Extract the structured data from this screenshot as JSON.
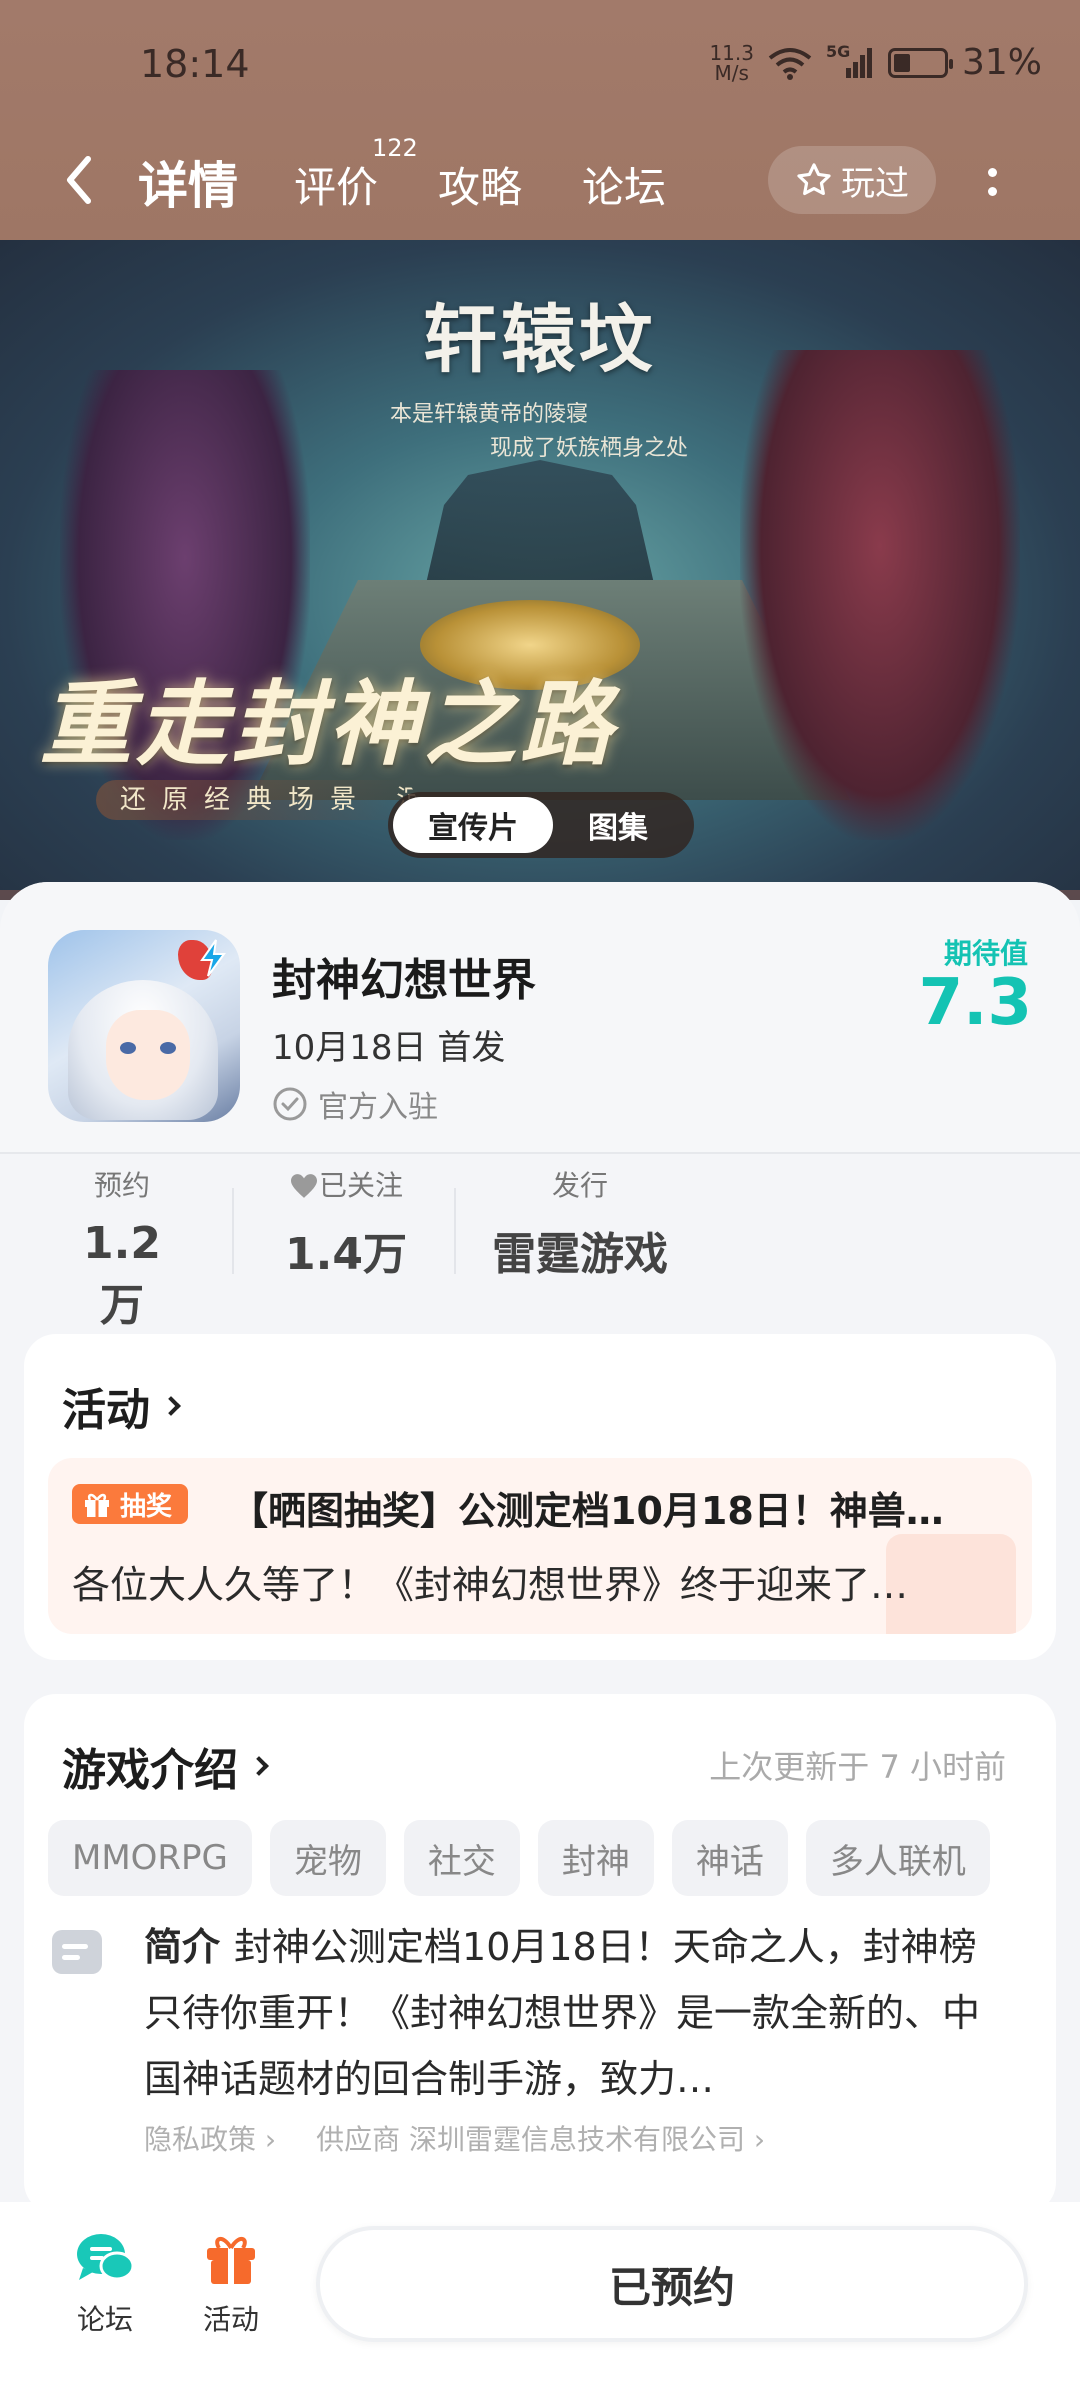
{
  "status_bar": {
    "time": "18:14",
    "net_speed_value": "11.3",
    "net_speed_unit": "M/s",
    "network": "5G",
    "battery": "31%"
  },
  "nav": {
    "tabs": [
      {
        "label": "详情",
        "active": true
      },
      {
        "label": "评价",
        "badge": "122"
      },
      {
        "label": "攻略"
      },
      {
        "label": "论坛"
      }
    ],
    "played_label": "玩过"
  },
  "banner": {
    "title": "轩辕坟",
    "subtitle_line1": "本是轩辕黄帝的陵寝",
    "subtitle_line2": "现成了妖族栖身之处",
    "slogan": "重走封神之路",
    "tagline": "还原经典场景 沉",
    "tabs": [
      "宣传片",
      "图集"
    ]
  },
  "game": {
    "name": "封神幻想世界",
    "release": "10月18日 首发",
    "official": "官方入驻",
    "expect_label": "期待值",
    "expect_value": "7.3"
  },
  "stats": [
    {
      "label": "预约",
      "value": "1.2万"
    },
    {
      "label": "已关注",
      "value": "1.4万"
    },
    {
      "label": "发行",
      "value": "雷霆游戏"
    }
  ],
  "activity": {
    "title": "活动",
    "badge": "抽奖",
    "item_title": "【晒图抽奖】公测定档10月18日！神兽…",
    "item_desc": "各位大人久等了！《封神幻想世界》终于迎来了…"
  },
  "intro": {
    "title": "游戏介绍",
    "updated": "上次更新于 7 小时前",
    "tags": [
      "MMORPG",
      "宠物",
      "社交",
      "封神",
      "神话",
      "多人联机"
    ],
    "label": "简介",
    "text": "封神公测定档10月18日！天命之人，封神榜只待你重开！《封神幻想世界》是一款全新的、中国神话题材的回合制手游，致力…",
    "privacy": "隐私政策",
    "supplier": "供应商 深圳雷霆信息技术有限公司"
  },
  "bottom": {
    "forum": "论坛",
    "activity": "活动",
    "reserve": "已预约"
  },
  "colors": {
    "accent": "#14c3b3",
    "header_bg": "#9d7563",
    "activity_badge": "#fb7a3c"
  }
}
